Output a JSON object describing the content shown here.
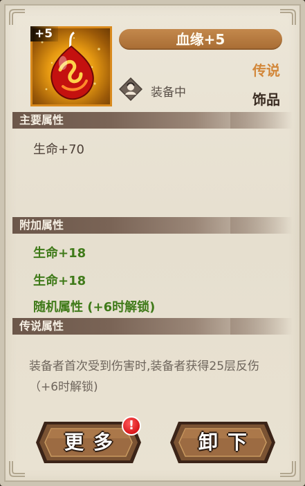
{
  "item": {
    "enhance_level": "+5",
    "name": "血缘+5",
    "rarity": "传说",
    "category": "饰品",
    "equipped_label": "装备中",
    "rarity_color": "#d2873a",
    "icon": "blood-drop-pendant-icon"
  },
  "sections": {
    "main": {
      "title": "主要属性",
      "stats": [
        "生命+70"
      ]
    },
    "extra": {
      "title": "附加属性",
      "stats": [
        "生命+18",
        "生命+18",
        "随机属性 (+6时解锁)"
      ],
      "color": "#3f7a19"
    },
    "legend": {
      "title": "传说属性",
      "description": "装备者首次受到伤害时,装备者获得25层反伤（+6时解锁)"
    }
  },
  "buttons": {
    "more": "更多",
    "unequip": "卸下",
    "more_alert": "!"
  }
}
